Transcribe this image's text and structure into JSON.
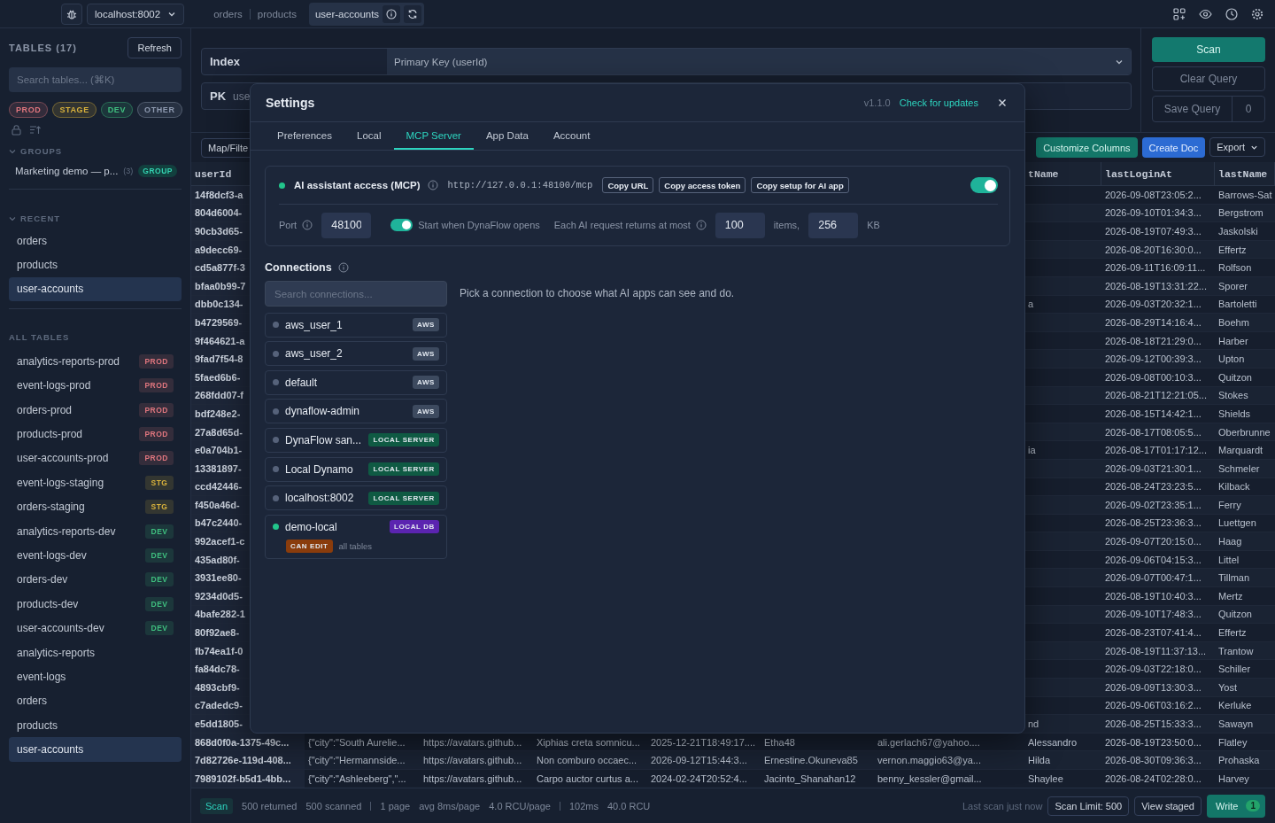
{
  "top_bar": {
    "connection": "localhost:8002",
    "tabs": [
      {
        "label": "orders",
        "selected": false
      },
      {
        "label": "products",
        "selected": false
      },
      {
        "label": "user-accounts",
        "selected": true
      }
    ]
  },
  "sidebar": {
    "title": "TABLES (17)",
    "refresh": "Refresh",
    "search_placeholder": "Search tables... (⌘K)",
    "env_filters": [
      {
        "label": "PROD",
        "color": "#e0767e"
      },
      {
        "label": "STAGE",
        "color": "#d9b23c"
      },
      {
        "label": "DEV",
        "color": "#3fbf7f"
      },
      {
        "label": "OTHER",
        "color": "#8e9ab0"
      }
    ],
    "groups": {
      "title": "GROUPS",
      "expanded": true,
      "items": [
        {
          "name": "Marketing demo — p...",
          "count": "(3)",
          "badge": "GROUP"
        }
      ]
    },
    "recent": {
      "title": "RECENT",
      "expanded": true,
      "items": [
        {
          "name": "orders",
          "selected": false
        },
        {
          "name": "products",
          "selected": false
        },
        {
          "name": "user-accounts",
          "selected": true
        }
      ]
    },
    "all_tables": {
      "title": "ALL TABLES",
      "items": [
        {
          "name": "analytics-reports-prod",
          "selected": false,
          "tag": {
            "label": "PROD",
            "color": "#e0767e"
          }
        },
        {
          "name": "event-logs-prod",
          "selected": false,
          "tag": {
            "label": "PROD",
            "color": "#e0767e"
          }
        },
        {
          "name": "orders-prod",
          "selected": false,
          "tag": {
            "label": "PROD",
            "color": "#e0767e"
          }
        },
        {
          "name": "products-prod",
          "selected": false,
          "tag": {
            "label": "PROD",
            "color": "#e0767e"
          }
        },
        {
          "name": "user-accounts-prod",
          "selected": false,
          "tag": {
            "label": "PROD",
            "color": "#e0767e"
          }
        },
        {
          "name": "event-logs-staging",
          "selected": false,
          "tag": {
            "label": "STG",
            "color": "#d9b23c"
          }
        },
        {
          "name": "orders-staging",
          "selected": false,
          "tag": {
            "label": "STG",
            "color": "#d9b23c"
          }
        },
        {
          "name": "analytics-reports-dev",
          "selected": false,
          "tag": {
            "label": "DEV",
            "color": "#3fbf7f"
          }
        },
        {
          "name": "event-logs-dev",
          "selected": false,
          "tag": {
            "label": "DEV",
            "color": "#3fbf7f"
          }
        },
        {
          "name": "orders-dev",
          "selected": false,
          "tag": {
            "label": "DEV",
            "color": "#3fbf7f"
          }
        },
        {
          "name": "products-dev",
          "selected": false,
          "tag": {
            "label": "DEV",
            "color": "#3fbf7f"
          }
        },
        {
          "name": "user-accounts-dev",
          "selected": false,
          "tag": {
            "label": "DEV",
            "color": "#3fbf7f"
          }
        },
        {
          "name": "analytics-reports",
          "selected": false
        },
        {
          "name": "event-logs",
          "selected": false
        },
        {
          "name": "orders",
          "selected": false
        },
        {
          "name": "products",
          "selected": false
        },
        {
          "name": "user-accounts",
          "selected": true
        }
      ]
    }
  },
  "query": {
    "index_label": "Index",
    "index_value": "Primary Key (userId)",
    "pk_label": "PK",
    "pk_value": "use"
  },
  "actions": {
    "scan": "Scan",
    "clear": "Clear Query",
    "save": "Save Query",
    "saved_count": "0"
  },
  "toolbar": {
    "filter": "Map/Filte",
    "customize": "Customize Columns",
    "create_doc": "Create Doc",
    "export": "Export"
  },
  "table": {
    "columns": [
      "userId",
      null,
      null,
      null,
      null,
      null,
      null,
      "tName",
      "lastLoginAt",
      "lastName"
    ],
    "rows": [
      [
        "14f8dcf3-a",
        null,
        null,
        null,
        null,
        null,
        null,
        null,
        "2026-09-08T23:05:2...",
        "Barrows-Sat"
      ],
      [
        "804d6004-",
        null,
        null,
        null,
        null,
        null,
        null,
        null,
        "2026-09-10T01:34:3...",
        "Bergstrom"
      ],
      [
        "90cb3d65-",
        null,
        null,
        null,
        null,
        null,
        null,
        null,
        "2026-08-19T07:49:3...",
        "Jaskolski"
      ],
      [
        "a9decc69-",
        null,
        null,
        null,
        null,
        null,
        null,
        null,
        "2026-08-20T16:30:0...",
        "Effertz"
      ],
      [
        "cd5a877f-3",
        null,
        null,
        null,
        null,
        null,
        null,
        null,
        "2026-09-11T16:09:11...",
        "Rolfson"
      ],
      [
        "bfaa0b99-7",
        null,
        null,
        null,
        null,
        null,
        null,
        null,
        "2026-08-19T13:31:22...",
        "Sporer"
      ],
      [
        "dbb0c134-",
        null,
        null,
        null,
        null,
        null,
        null,
        "a",
        "2026-09-03T20:32:1...",
        "Bartoletti"
      ],
      [
        "b4729569-",
        null,
        null,
        null,
        null,
        null,
        null,
        null,
        "2026-08-29T14:16:4...",
        "Boehm"
      ],
      [
        "9f464621-a",
        null,
        null,
        null,
        null,
        null,
        null,
        null,
        "2026-08-18T21:29:0...",
        "Harber"
      ],
      [
        "9fad7f54-8",
        null,
        null,
        null,
        null,
        null,
        null,
        null,
        "2026-09-12T00:39:3...",
        "Upton"
      ],
      [
        "5faed6b6-",
        null,
        null,
        null,
        null,
        null,
        null,
        null,
        "2026-09-08T00:10:3...",
        "Quitzon"
      ],
      [
        "268fdd07-f",
        null,
        null,
        null,
        null,
        null,
        null,
        null,
        "2026-08-21T12:21:05...",
        "Stokes"
      ],
      [
        "bdf248e2-",
        null,
        null,
        null,
        null,
        null,
        null,
        null,
        "2026-08-15T14:42:1...",
        "Shields"
      ],
      [
        "27a8d65d-",
        null,
        null,
        null,
        null,
        null,
        null,
        null,
        "2026-08-17T08:05:5...",
        "Oberbrunne"
      ],
      [
        "e0a704b1-",
        null,
        null,
        null,
        null,
        null,
        null,
        "ia",
        "2026-08-17T01:17:12...",
        "Marquardt"
      ],
      [
        "13381897-",
        null,
        null,
        null,
        null,
        null,
        null,
        null,
        "2026-09-03T21:30:1...",
        "Schmeler"
      ],
      [
        "ccd42446-",
        null,
        null,
        null,
        null,
        null,
        null,
        null,
        "2026-08-24T23:23:5...",
        "Kilback"
      ],
      [
        "f450a46d-",
        null,
        null,
        null,
        null,
        null,
        null,
        null,
        "2026-09-02T23:35:1...",
        "Ferry"
      ],
      [
        "b47c2440-",
        null,
        null,
        null,
        null,
        null,
        null,
        null,
        "2026-08-25T23:36:3...",
        "Luettgen"
      ],
      [
        "992acef1-c",
        null,
        null,
        null,
        null,
        null,
        null,
        null,
        "2026-09-07T20:15:0...",
        "Haag"
      ],
      [
        "435ad80f-",
        null,
        null,
        null,
        null,
        null,
        null,
        null,
        "2026-09-06T04:15:3...",
        "Littel"
      ],
      [
        "3931ee80-",
        null,
        null,
        null,
        null,
        null,
        null,
        null,
        "2026-09-07T00:47:1...",
        "Tillman"
      ],
      [
        "9234d0d5-",
        null,
        null,
        null,
        null,
        null,
        null,
        null,
        "2026-08-19T10:40:3...",
        "Mertz"
      ],
      [
        "4bafe282-1",
        null,
        null,
        null,
        null,
        null,
        null,
        null,
        "2026-09-10T17:48:3...",
        "Quitzon"
      ],
      [
        "80f92ae8-",
        null,
        null,
        null,
        null,
        null,
        null,
        null,
        "2026-08-23T07:41:4...",
        "Effertz"
      ],
      [
        "fb74ea1f-0",
        null,
        null,
        null,
        null,
        null,
        null,
        null,
        "2026-08-19T11:37:13...",
        "Trantow"
      ],
      [
        "fa84dc78-",
        null,
        null,
        null,
        null,
        null,
        null,
        null,
        "2026-09-03T22:18:0...",
        "Schiller"
      ],
      [
        "4893cbf9-",
        null,
        null,
        null,
        null,
        null,
        null,
        null,
        "2026-09-09T13:30:3...",
        "Yost"
      ],
      [
        "c7adedc9-",
        null,
        null,
        null,
        null,
        null,
        null,
        null,
        "2026-09-06T03:16:2...",
        "Kerluke"
      ],
      [
        "e5dd1805-",
        null,
        null,
        null,
        null,
        null,
        null,
        "nd",
        "2026-08-25T15:33:3...",
        "Sawayn"
      ],
      [
        "868d0f0a-1375-49c...",
        "{\"city\":\"South Aurelie...",
        "https://avatars.github...",
        "Xiphias creta somnicu...",
        "2025-12-21T18:49:17....",
        "Etha48",
        "ali.gerlach67@yahoo....",
        "Alessandro",
        "2026-08-19T23:50:0...",
        "Flatley"
      ],
      [
        "7d82726e-119d-408...",
        "{\"city\":\"Hermannside...",
        "https://avatars.github...",
        "Non comburo occaec...",
        "2026-09-12T15:44:3...",
        "Ernestine.Okuneva85",
        "vernon.maggio63@ya...",
        "Hilda",
        "2026-08-30T09:36:3...",
        "Prohaska"
      ],
      [
        "7989102f-b5d1-4bb...",
        "{\"city\":\"Ashleeberg\",\"...",
        "https://avatars.github...",
        "Carpo auctor curtus a...",
        "2024-02-24T20:52:4...",
        "Jacinto_Shanahan12",
        "benny_kessler@gmail...",
        "Shaylee",
        "2026-08-24T02:28:0...",
        "Harvey"
      ]
    ]
  },
  "status_bar": {
    "mode": "Scan",
    "stat_groups": [
      [
        "500 returned",
        "500 scanned"
      ],
      [
        "1 page",
        "avg 8ms/page",
        "4.0 RCU/page"
      ],
      [
        "102ms",
        "40.0 RCU"
      ]
    ],
    "last_scan": "Last scan just now",
    "scan_limit": "Scan Limit: 500",
    "view_staged": "View staged",
    "write": "Write",
    "write_count": "1"
  },
  "settings": {
    "title": "Settings",
    "version": "v1.1.0",
    "update_link": "Check for updates",
    "tabs": [
      {
        "label": "Preferences",
        "selected": false
      },
      {
        "label": "Local",
        "selected": false
      },
      {
        "label": "MCP Server",
        "selected": true
      },
      {
        "label": "App Data",
        "selected": false
      },
      {
        "label": "Account",
        "selected": false
      }
    ],
    "mcp": {
      "running": true,
      "title": "AI assistant access (MCP)",
      "url": "http://127.0.0.1:48100/mcp",
      "buttons": [
        "Copy URL",
        "Copy access token",
        "Copy setup for AI app"
      ],
      "on": true,
      "port_label": "Port",
      "port": "48100",
      "autostart": {
        "on": true,
        "label": "Start when DynaFlow opens"
      },
      "limit_label": "Each AI request returns at most",
      "items_value": "100",
      "items_unit": "items,",
      "kb_value": "256",
      "kb_unit": "KB"
    },
    "connections": {
      "title": "Connections",
      "search_placeholder": "Search connections...",
      "hint": "Pick a connection to choose what AI apps can see and do.",
      "items": [
        {
          "name": "aws_user_1",
          "enabled": false,
          "badge": {
            "label": "AWS",
            "color": "#3d4a5f"
          }
        },
        {
          "name": "aws_user_2",
          "enabled": false,
          "badge": {
            "label": "AWS",
            "color": "#3d4a5f"
          }
        },
        {
          "name": "default",
          "enabled": false,
          "badge": {
            "label": "AWS",
            "color": "#3d4a5f"
          }
        },
        {
          "name": "dynaflow-admin",
          "enabled": false,
          "badge": {
            "label": "AWS",
            "color": "#3d4a5f"
          }
        },
        {
          "name": "DynaFlow san...",
          "enabled": false,
          "badge": {
            "label": "LOCAL SERVER",
            "color": "#0f5a43"
          }
        },
        {
          "name": "Local Dynamo",
          "enabled": false,
          "badge": {
            "label": "LOCAL SERVER",
            "color": "#0f5a43"
          }
        },
        {
          "name": "localhost:8002",
          "enabled": false,
          "badge": {
            "label": "LOCAL SERVER",
            "color": "#0f5a43"
          }
        },
        {
          "name": "demo-local",
          "enabled": true,
          "badge": {
            "label": "LOCAL DB",
            "color": "#5b24b0"
          },
          "permission": {
            "label": "CAN EDIT",
            "color": "#8a3c0c"
          },
          "scope": "all tables"
        }
      ]
    }
  }
}
